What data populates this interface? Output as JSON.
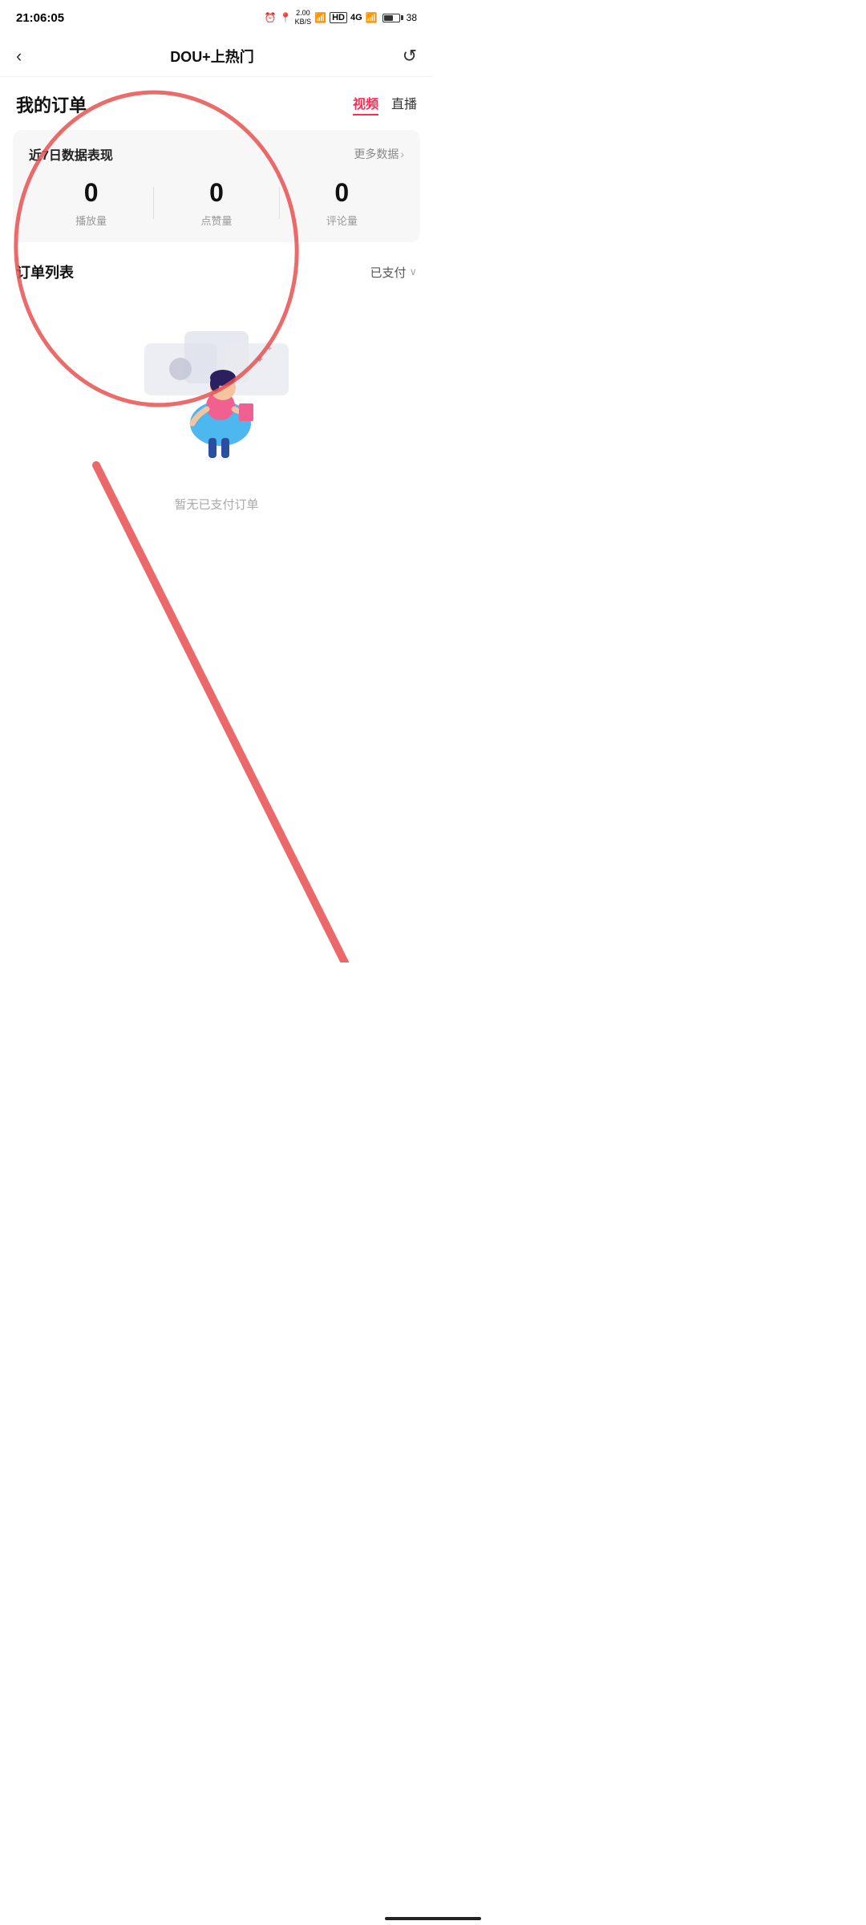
{
  "statusBar": {
    "time": "21:06:05",
    "networkSpeed": "2.00\nKB/S",
    "batteryLevel": 38
  },
  "navBar": {
    "title": "DOU+上热门",
    "backIcon": "‹",
    "refreshIcon": "↺"
  },
  "orderSection": {
    "title": "我的订单",
    "tabs": [
      {
        "label": "视频",
        "active": true
      },
      {
        "label": "直播",
        "active": false
      }
    ]
  },
  "dataCard": {
    "title": "近7日数据表现",
    "moreLabel": "更多数据",
    "stats": [
      {
        "value": "0",
        "label": "播放量"
      },
      {
        "value": "0",
        "label": "点赞量"
      },
      {
        "value": "0",
        "label": "评论量"
      }
    ]
  },
  "orderList": {
    "title": "订单列表",
    "filterLabel": "已支付",
    "emptyText": "暂无已支付订单"
  },
  "colors": {
    "activeTab": "#fe2c55",
    "annotation": "#e85050"
  }
}
